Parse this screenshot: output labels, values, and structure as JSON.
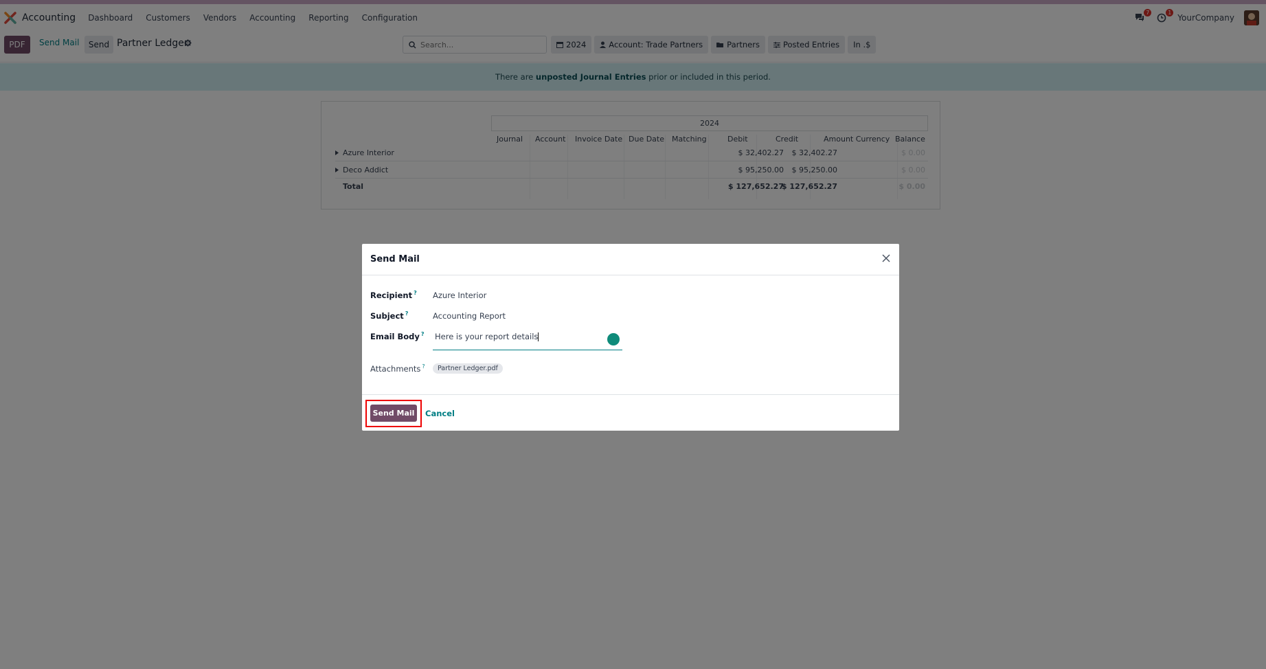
{
  "navbar": {
    "brand": "Accounting",
    "menu": [
      "Dashboard",
      "Customers",
      "Vendors",
      "Accounting",
      "Reporting",
      "Configuration"
    ],
    "messages_badge": "7",
    "activities_badge": "1",
    "company": "YourCompany"
  },
  "control_panel": {
    "pdf_label": "PDF",
    "send_mail_label": "Send Mail",
    "send_label": "Send",
    "title": "Partner Ledger",
    "search_placeholder": "Search...",
    "filters": [
      "2024",
      "Account: Trade Partners",
      "Partners",
      "Posted Entries",
      "In .$"
    ]
  },
  "alert": {
    "prefix": "There are ",
    "bold": "unposted Journal Entries",
    "suffix": " prior or included in this period."
  },
  "report": {
    "period": "2024",
    "columns": [
      "Journal",
      "Account",
      "Invoice Date",
      "Due Date",
      "Matching",
      "Debit",
      "Credit",
      "Amount Currency",
      "Balance"
    ],
    "rows": [
      {
        "name": "Azure Interior",
        "debit": "$ 32,402.27",
        "credit": "$ 32,402.27",
        "balance": "$ 0.00"
      },
      {
        "name": "Deco Addict",
        "debit": "$ 95,250.00",
        "credit": "$ 95,250.00",
        "balance": "$ 0.00"
      }
    ],
    "total": {
      "name": "Total",
      "debit": "$ 127,652.27",
      "credit": "$ 127,652.27",
      "balance": "$ 0.00"
    }
  },
  "modal": {
    "title": "Send Mail",
    "recipient_label": "Recipient",
    "recipient_value": "Azure Interior",
    "subject_label": "Subject",
    "subject_value": "Accounting Report",
    "body_label": "Email Body",
    "body_value": "Here is your report details",
    "attachments_label": "Attachments",
    "attachment_file": "Partner Ledger.pdf",
    "qmark": "?",
    "send_button": "Send Mail",
    "cancel_button": "Cancel"
  },
  "colors": {
    "brand": "#714b67",
    "accent": "#017e84",
    "alert_bg": "#d0eef2",
    "highlight": "#ee0000"
  }
}
